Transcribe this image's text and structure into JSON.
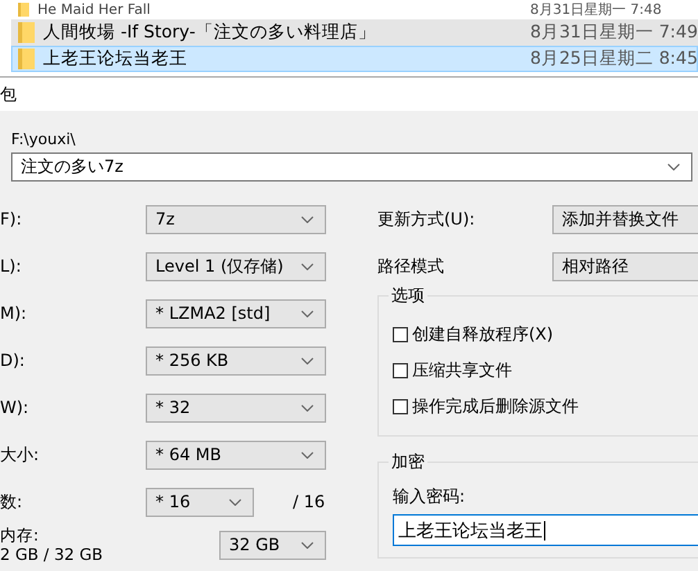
{
  "file_list": [
    {
      "name": "He Maid Her Fall",
      "date": "8月31日星期一 7:48",
      "hovered": false,
      "selected": false
    },
    {
      "name": "人間牧場 -If Story-「注文の多い料理店」",
      "date": "8月31日星期一 7:49",
      "hovered": true,
      "selected": false
    },
    {
      "name": "上老王论坛当老王",
      "date": "8月25日星期二 8:45",
      "hovered": false,
      "selected": true
    }
  ],
  "dialog_title": "包",
  "archive": {
    "path": "F:\\youxi\\",
    "name": "注文の多い7z"
  },
  "settings": [
    {
      "label": "F):",
      "value": "7z"
    },
    {
      "label": "L):",
      "value": "Level 1 (仅存储)"
    },
    {
      "label": "M):",
      "value": "* LZMA2 [std]"
    },
    {
      "label": "D):",
      "value": "* 256 KB"
    },
    {
      "label": "W):",
      "value": "* 32"
    },
    {
      "label": "大小:",
      "value": "* 64 MB"
    }
  ],
  "threads": {
    "label": "数:",
    "value": "* 16",
    "max": "/ 16"
  },
  "memory": {
    "label": "内存:",
    "usage": "2 GB / 32 GB",
    "value": "32 GB"
  },
  "update_mode": {
    "label": "更新方式(U):",
    "value": "添加并替换文件"
  },
  "path_mode": {
    "label": "路径模式",
    "value": "相对路径"
  },
  "options": {
    "title": "选项",
    "items": [
      {
        "label": "创建自释放程序(X)",
        "checked": false
      },
      {
        "label": "压缩共享文件",
        "checked": false
      },
      {
        "label": "操作完成后删除源文件",
        "checked": false
      }
    ]
  },
  "encryption": {
    "title": "加密",
    "label": "输入密码:",
    "value": "上老王论坛当老王"
  }
}
